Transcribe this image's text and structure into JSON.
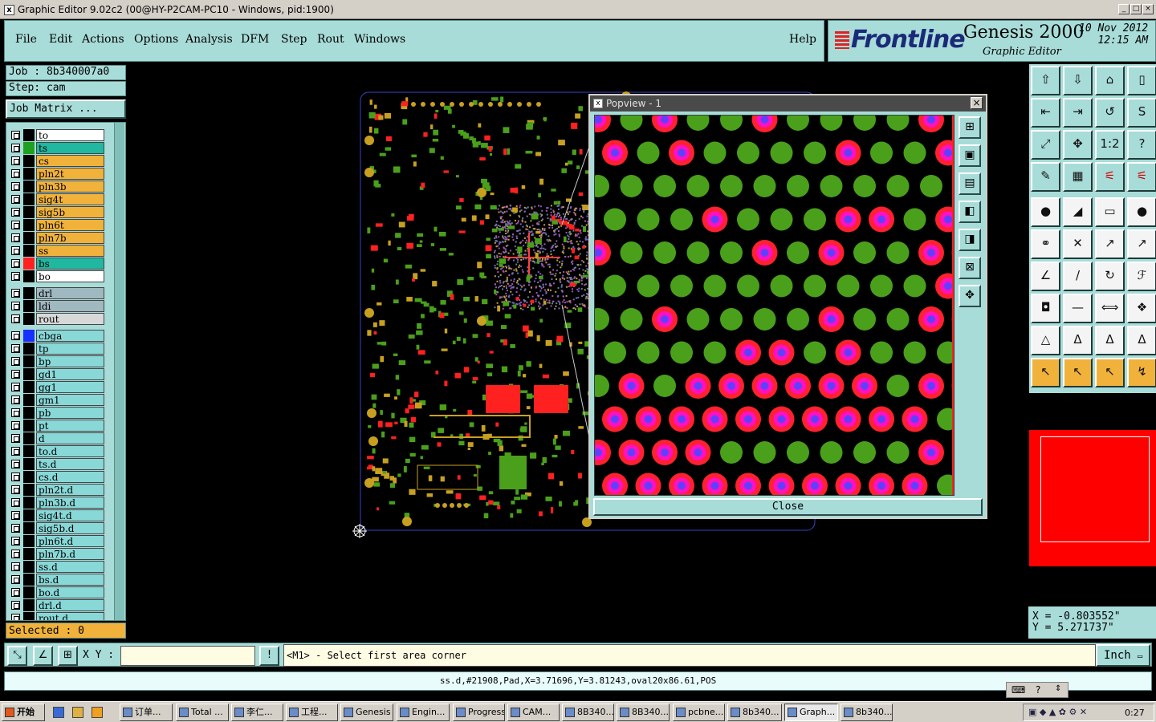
{
  "window": {
    "title": "Graphic Editor 9.02c2 (00@HY-P2CAM-PC10 - Windows, pid:1900)"
  },
  "menu": [
    "File",
    "Edit",
    "Actions",
    "Options",
    "Analysis",
    "DFM",
    "Step",
    "Rout",
    "Windows"
  ],
  "help": "Help",
  "brand": {
    "frontline": "Frontline",
    "product": "Genesis 2000",
    "subtitle": "Graphic Editor",
    "date": "10 Nov 2012",
    "time": "12:15 AM"
  },
  "job": "Job : 8b340007a0",
  "step": "Step: cam",
  "job_matrix": "Job Matrix ...",
  "layers_group1": [
    {
      "name": "to",
      "color": "#ffffff",
      "swatch": "#000000"
    },
    {
      "name": "ts",
      "color": "#20b8a0",
      "swatch": "#20a020"
    },
    {
      "name": "cs",
      "color": "#f0b23a",
      "swatch": "#000000"
    },
    {
      "name": "pln2t",
      "color": "#f0b23a",
      "swatch": "#000000"
    },
    {
      "name": "pln3b",
      "color": "#f0b23a",
      "swatch": "#000000"
    },
    {
      "name": "sig4t",
      "color": "#f0b23a",
      "swatch": "#000000"
    },
    {
      "name": "sig5b",
      "color": "#f0b23a",
      "swatch": "#000000"
    },
    {
      "name": "pln6t",
      "color": "#f0b23a",
      "swatch": "#000000"
    },
    {
      "name": "pln7b",
      "color": "#f0b23a",
      "swatch": "#000000"
    },
    {
      "name": "ss",
      "color": "#f0b23a",
      "swatch": "#000000"
    },
    {
      "name": "bs",
      "color": "#20b8a0",
      "swatch": "#ff2020"
    },
    {
      "name": "bo",
      "color": "#ffffff",
      "swatch": "#000000"
    }
  ],
  "layers_group2": [
    {
      "name": "drl",
      "color": "#a0b8c0",
      "swatch": "#000000"
    },
    {
      "name": "ldi",
      "color": "#a0b8c0",
      "swatch": "#000000"
    },
    {
      "name": "rout",
      "color": "#d8d8d8",
      "swatch": "#000000"
    }
  ],
  "layers_group3": [
    {
      "name": "cbga",
      "color": "#88d8d8",
      "swatch": "#1830ff"
    },
    {
      "name": "tp",
      "color": "#88d8d8",
      "swatch": "#000000"
    },
    {
      "name": "bp",
      "color": "#88d8d8",
      "swatch": "#000000"
    },
    {
      "name": "gd1",
      "color": "#88d8d8",
      "swatch": "#000000"
    },
    {
      "name": "gg1",
      "color": "#88d8d8",
      "swatch": "#000000"
    },
    {
      "name": "gm1",
      "color": "#88d8d8",
      "swatch": "#000000"
    },
    {
      "name": "pb",
      "color": "#88d8d8",
      "swatch": "#000000"
    },
    {
      "name": "pt",
      "color": "#88d8d8",
      "swatch": "#000000"
    },
    {
      "name": "d",
      "color": "#88d8d8",
      "swatch": "#000000"
    },
    {
      "name": "to.d",
      "color": "#88d8d8",
      "swatch": "#000000"
    },
    {
      "name": "ts.d",
      "color": "#88d8d8",
      "swatch": "#000000"
    },
    {
      "name": "cs.d",
      "color": "#88d8d8",
      "swatch": "#000000"
    },
    {
      "name": "pln2t.d",
      "color": "#88d8d8",
      "swatch": "#000000"
    },
    {
      "name": "pln3b.d",
      "color": "#88d8d8",
      "swatch": "#000000"
    },
    {
      "name": "sig4t.d",
      "color": "#88d8d8",
      "swatch": "#000000"
    },
    {
      "name": "sig5b.d",
      "color": "#88d8d8",
      "swatch": "#000000"
    },
    {
      "name": "pln6t.d",
      "color": "#88d8d8",
      "swatch": "#000000"
    },
    {
      "name": "pln7b.d",
      "color": "#88d8d8",
      "swatch": "#000000"
    },
    {
      "name": "ss.d",
      "color": "#88d8d8",
      "swatch": "#000000"
    },
    {
      "name": "bs.d",
      "color": "#88d8d8",
      "swatch": "#000000"
    },
    {
      "name": "bo.d",
      "color": "#88d8d8",
      "swatch": "#000000"
    },
    {
      "name": "drl.d",
      "color": "#88d8d8",
      "swatch": "#000000"
    },
    {
      "name": "rout.d",
      "color": "#88d8d8",
      "swatch": "#000000"
    }
  ],
  "selected": "Selected : 0",
  "popup": {
    "title": "Popview - 1",
    "close": "Close"
  },
  "coords": {
    "x": "X = -0.803552\"",
    "y": "Y = 5.271737\""
  },
  "command": {
    "xy_label": "X Y :",
    "xy_value": "",
    "prompt": "<M1> - Select first area corner",
    "unit": "Inch"
  },
  "status": "ss.d,#21908,Pad,X=3.71696,Y=3.81243,oval20x86.61,POS",
  "taskbar": {
    "start": "开始",
    "items": [
      "订单...",
      "Total ...",
      "李仁...",
      "工程...",
      "Genesis",
      "Engin...",
      "Progress",
      "CAM...",
      "8B340...",
      "8B340...",
      "pcbne...",
      "8b340...",
      "Graph...",
      "8b340..."
    ],
    "clock": "0:27"
  },
  "toolbox_icons": [
    "up-layer-icon",
    "down-layer-icon",
    "home-icon",
    "zoom-window-icon",
    "prev-icon",
    "next-icon",
    "redo-icon",
    "s-curve-icon",
    "fit-all-icon",
    "zoom-center-icon",
    "ratio-1-2-icon",
    "question-icon",
    "measure-tool-icon",
    "grid-icon",
    "snap-red-icon",
    "snap-red2-icon",
    "dot-arrow-icon",
    "flag-icon",
    "ruler-icon",
    "circle-icon",
    "connect-icon",
    "cross-icon",
    "line-arrow-icon",
    "line-arrow2-icon",
    "angle-icon",
    "slash-icon",
    "rotate-icon",
    "ff-icon",
    "square-dot-icon",
    "minus-icon",
    "dim-icon",
    "blue-shapes-icon",
    "triangle-icon",
    "triangle-a-icon",
    "triangle-b-icon",
    "triangle-c-icon",
    "pointer-icon",
    "pointer2-icon",
    "pointer3-icon",
    "pointer4-icon"
  ]
}
